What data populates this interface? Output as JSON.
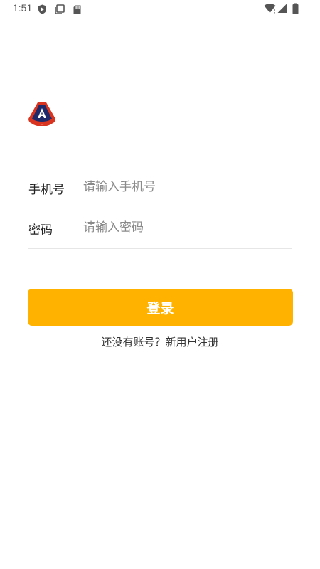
{
  "status_bar": {
    "time": "1:51",
    "left_icons": [
      "play-protect-icon",
      "screenshot-icon",
      "sd-card-icon"
    ],
    "right_icons": [
      "wifi-icon",
      "signal-icon",
      "battery-icon"
    ]
  },
  "logo": {
    "name": "app-logo",
    "colors": {
      "outer": "#d9341f",
      "inner": "#1f2a6b"
    }
  },
  "form": {
    "phone": {
      "label": "手机号",
      "placeholder": "请输入手机号",
      "value": ""
    },
    "password": {
      "label": "密码",
      "placeholder": "请输入密码",
      "value": ""
    }
  },
  "login_button": {
    "label": "登录",
    "color": "#ffb300"
  },
  "register": {
    "text": "还没有账号？新用户注册"
  }
}
